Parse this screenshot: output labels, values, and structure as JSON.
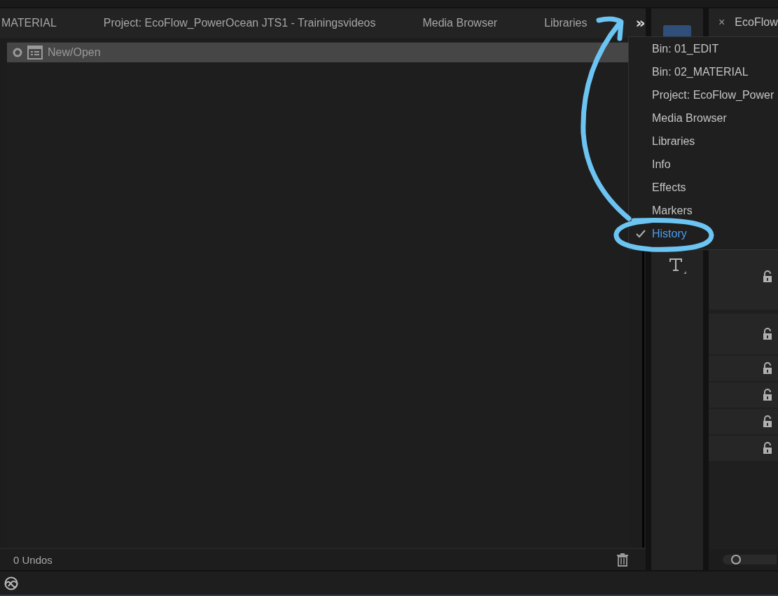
{
  "tabs": [
    {
      "label": "MATERIAL"
    },
    {
      "label": "Project: EcoFlow_PowerOcean JTS1 - Trainingsvideos"
    },
    {
      "label": "Media Browser"
    },
    {
      "label": "Libraries"
    }
  ],
  "overflow_button": {
    "label": "»"
  },
  "history": {
    "items": [
      {
        "label": "New/Open",
        "selected": true
      }
    ],
    "footer": "0 Undos"
  },
  "panel_menu": {
    "items": [
      {
        "label": "Bin: 01_EDIT",
        "checked": false
      },
      {
        "label": "Bin: 02_MATERIAL",
        "checked": false
      },
      {
        "label": "Project: EcoFlow_Power",
        "checked": false
      },
      {
        "label": "Media Browser",
        "checked": false
      },
      {
        "label": "Libraries",
        "checked": false
      },
      {
        "label": "Info",
        "checked": false
      },
      {
        "label": "Effects",
        "checked": false
      },
      {
        "label": "Markers",
        "checked": false
      },
      {
        "label": "History",
        "checked": true
      }
    ]
  },
  "timeline": {
    "tab": {
      "close": "×",
      "label": "EcoFlow"
    },
    "tracks": [
      {
        "locked": false
      },
      {
        "locked": false
      },
      {
        "locked": false
      },
      {
        "locked": false
      },
      {
        "locked": false
      },
      {
        "locked": false
      }
    ]
  }
}
